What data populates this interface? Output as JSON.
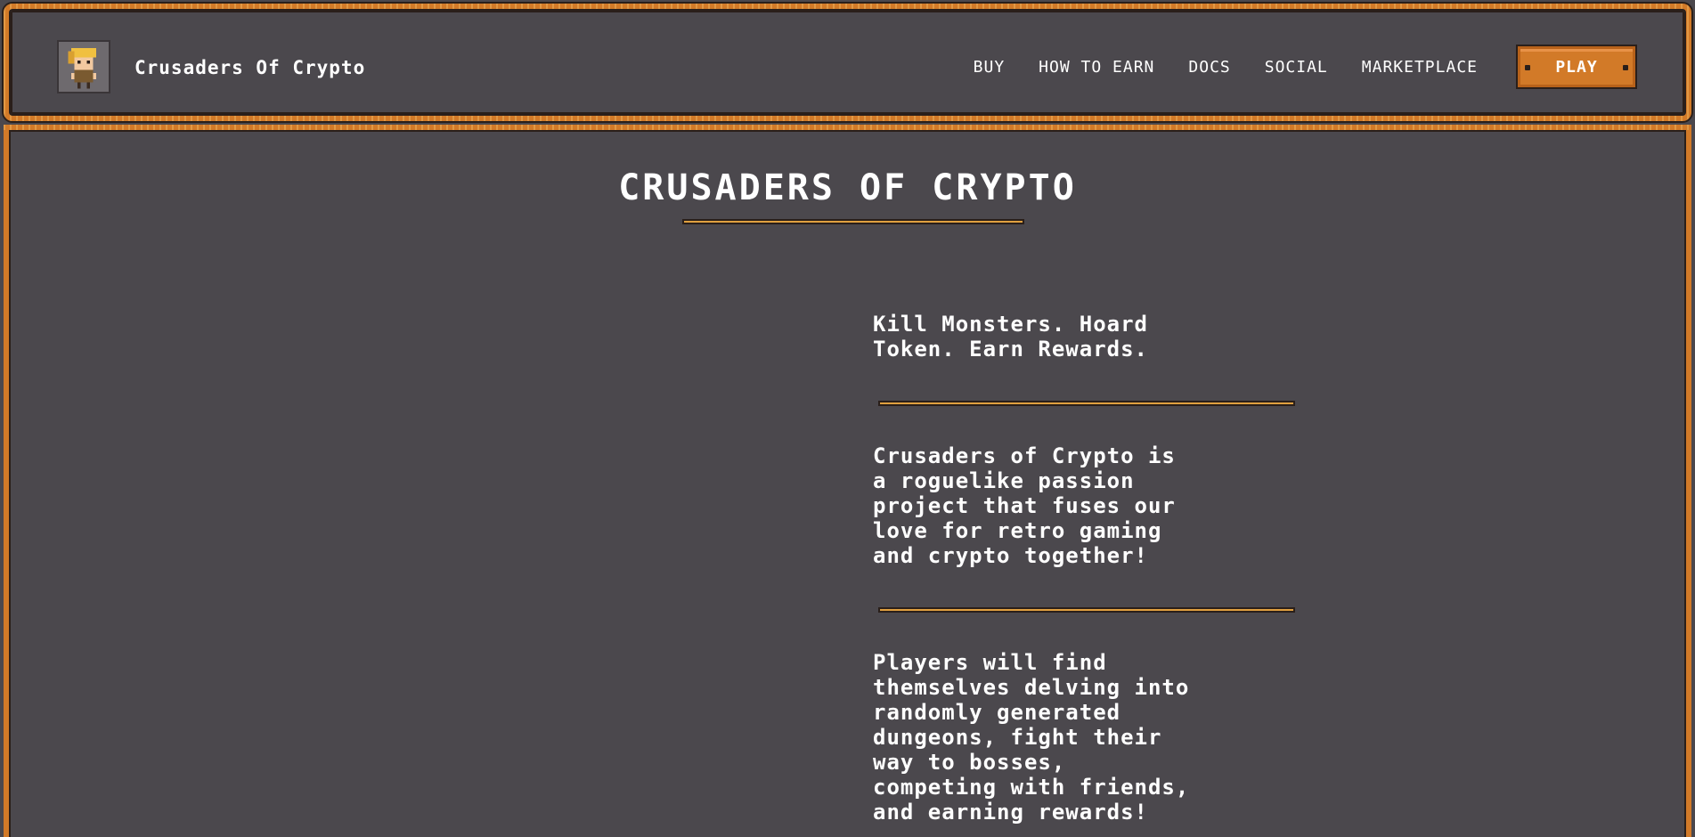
{
  "header": {
    "logo_icon": "knight-avatar-icon",
    "brand": "Crusaders Of Crypto",
    "nav": [
      {
        "label": "BUY",
        "name": "nav-buy"
      },
      {
        "label": "HOW TO EARN",
        "name": "nav-how-to-earn"
      },
      {
        "label": "DOCS",
        "name": "nav-docs"
      },
      {
        "label": "SOCIAL",
        "name": "nav-social"
      },
      {
        "label": "MARKETPLACE",
        "name": "nav-marketplace"
      }
    ],
    "play_label": "PLAY"
  },
  "main": {
    "title": "CRUSADERS OF CRYPTO",
    "tagline": "Kill Monsters. Hoard\nToken. Earn Rewards.",
    "description": "Crusaders of Crypto is\na roguelike passion\nproject that fuses our\nlove for retro gaming\nand crypto together!",
    "gameplay": "Players will find\nthemselves delving into\nrandomly generated\ndungeons, fight their\nway to bosses,\ncompeting with friends,\nand earning rewards!"
  },
  "colors": {
    "background": "#4b484d",
    "frame_orange": "#d27a28",
    "divider_gold": "#e0a040",
    "outline_dark": "#2a1f1a"
  }
}
